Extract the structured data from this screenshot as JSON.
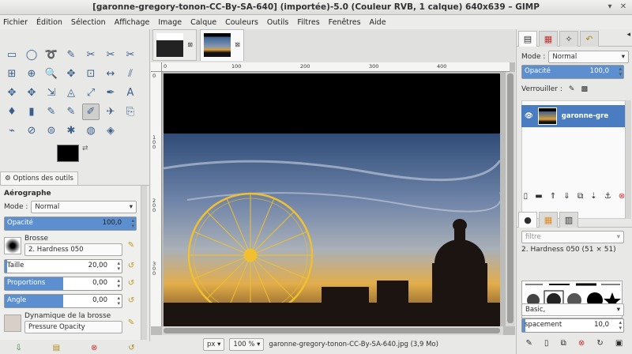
{
  "window": {
    "title": "[garonne-gregory-tonon-CC-By-SA-640] (importée)-5.0 (Couleur RVB, 1 calque) 640x639 – GIMP",
    "minimize": "▾",
    "close": "✕"
  },
  "menu": [
    "Fichier",
    "Édition",
    "Sélection",
    "Affichage",
    "Image",
    "Calque",
    "Couleurs",
    "Outils",
    "Filtres",
    "Fenêtres",
    "Aide"
  ],
  "tool_options": {
    "tab_label": "Options des outils",
    "tool_name": "Aérographe",
    "mode_label": "Mode :",
    "mode_value": "Normal",
    "opacity_label": "Opacité",
    "opacity_value": "100,0",
    "brush_label": "Brosse",
    "brush_value": "2. Hardness 050",
    "size_label": "Taille",
    "size_value": "20,00",
    "proportions_label": "Proportions",
    "proportions_value": "0,00",
    "angle_label": "Angle",
    "angle_value": "0,00",
    "dynamics_label": "Dynamique de la brosse",
    "dynamics_value": "Pressure Opacity"
  },
  "status": {
    "unit": "px",
    "zoom": "100 %",
    "file_info": "garonne-gregory-tonon-CC-By-SA-640.jpg (3,9 Mo)"
  },
  "ruler": {
    "h": [
      "0",
      "100",
      "200",
      "300",
      "400"
    ],
    "v": [
      "0",
      "100",
      "200",
      "300"
    ]
  },
  "layers": {
    "mode_label": "Mode :",
    "mode_value": "Normal",
    "opacity_label": "Opacité",
    "opacity_value": "100,0",
    "lock_label": "Verrouiller :",
    "layer_name": "garonne-gre"
  },
  "brushes": {
    "filter_placeholder": "filtre",
    "brush_title": "2. Hardness 050 (51 × 51)",
    "preset": "Basic,",
    "spacing_label": "spacement",
    "spacing_value": "10,0"
  },
  "colors": {
    "accent": "#5b8fd0",
    "selection": "#4a7cc2"
  }
}
